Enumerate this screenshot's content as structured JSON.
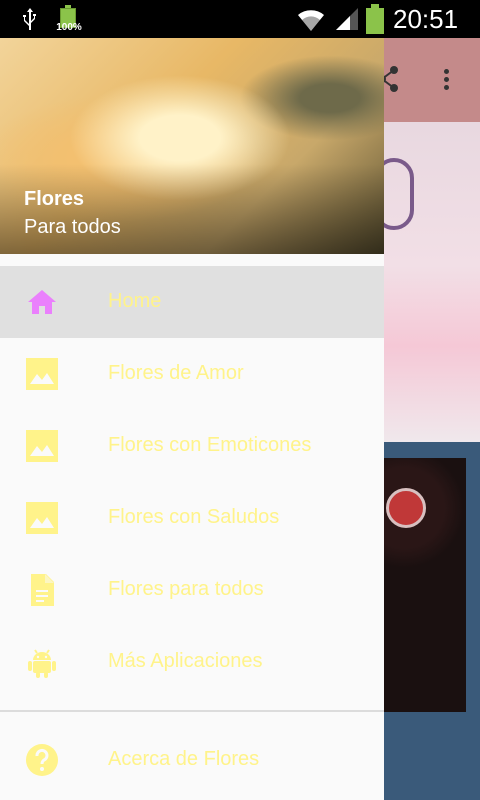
{
  "status_bar": {
    "battery_percent": "100%",
    "time": "20:51"
  },
  "drawer": {
    "header": {
      "title": "Flores",
      "subtitle": "Para todos"
    },
    "items": [
      {
        "label": "Home",
        "icon": "home-icon",
        "selected": true
      },
      {
        "label": "Flores de Amor",
        "icon": "image-icon"
      },
      {
        "label": "Flores con Emoticones",
        "icon": "image-icon"
      },
      {
        "label": "Flores con Saludos",
        "icon": "image-icon"
      },
      {
        "label": "Flores para todos",
        "icon": "document-icon"
      },
      {
        "label": "Más Aplicaciones",
        "icon": "android-icon"
      }
    ],
    "footer_items": [
      {
        "label": "Acerca de Flores",
        "icon": "help-icon"
      }
    ]
  },
  "colors": {
    "selected_icon": "#ea80fc",
    "label_text": "#fff38a",
    "icon_yellow": "#fff38a"
  }
}
